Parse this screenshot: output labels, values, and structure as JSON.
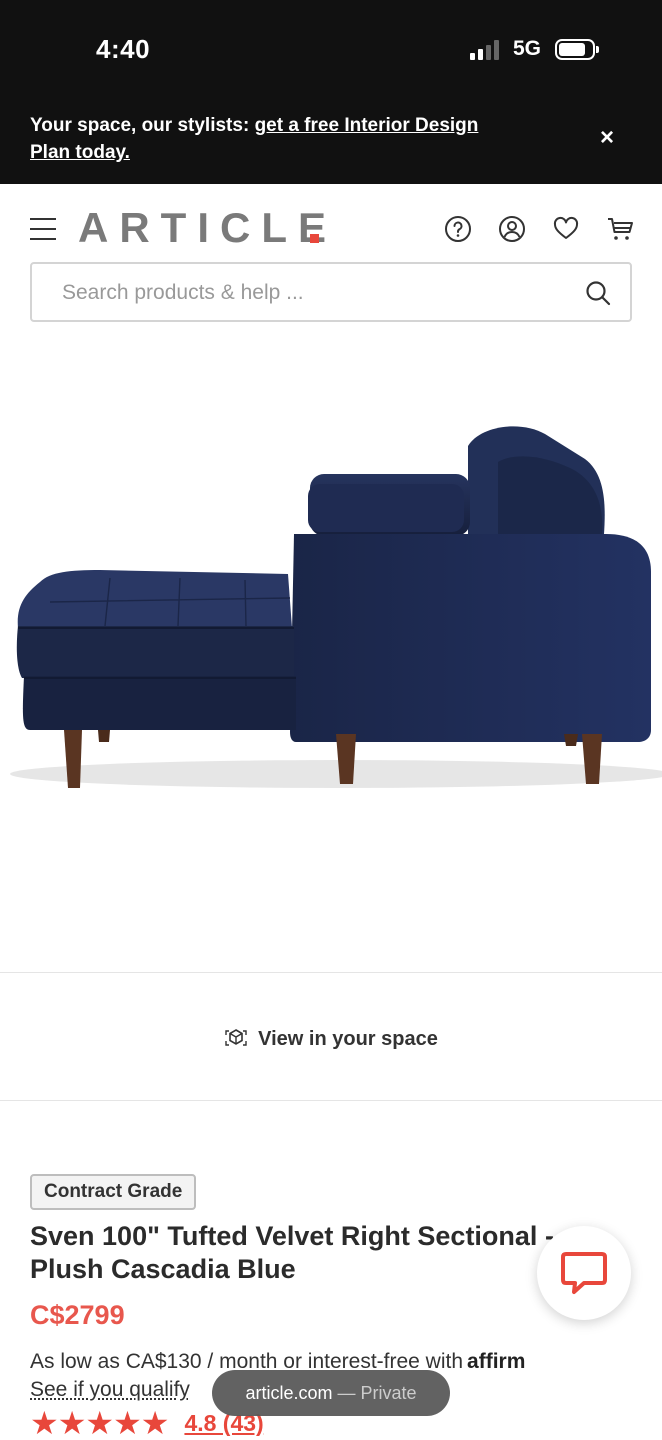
{
  "status_bar": {
    "time": "4:40",
    "network": "5G"
  },
  "promo": {
    "text": "Your space, our stylists: ",
    "link": "get a free Interior Design Plan today.",
    "close": "×"
  },
  "header": {
    "logo": "ARTICLE",
    "icons": [
      "menu-icon",
      "help-icon",
      "account-icon",
      "heart-icon",
      "cart-icon"
    ]
  },
  "search": {
    "placeholder": "Search products & help ..."
  },
  "view_in_space": {
    "label": "View in your space"
  },
  "product": {
    "badge": "Contract Grade",
    "title": "Sven 100\" Tufted Velvet Right Sectional - Plush Cascadia Blue",
    "price": "C$2799",
    "finance_text": "As low as CA$130 / month or interest-free with",
    "finance_brand": "affirm",
    "qualify_link": "See if you qualify",
    "stars": "★★★★★",
    "rating": "4.8 (43)"
  },
  "browser": {
    "domain": "article.com",
    "mode": "— Private"
  },
  "colors": {
    "accent": "#e8473b",
    "sofa": "#1d2a4e",
    "legs": "#5a3522",
    "dark_bar": "#111111"
  }
}
